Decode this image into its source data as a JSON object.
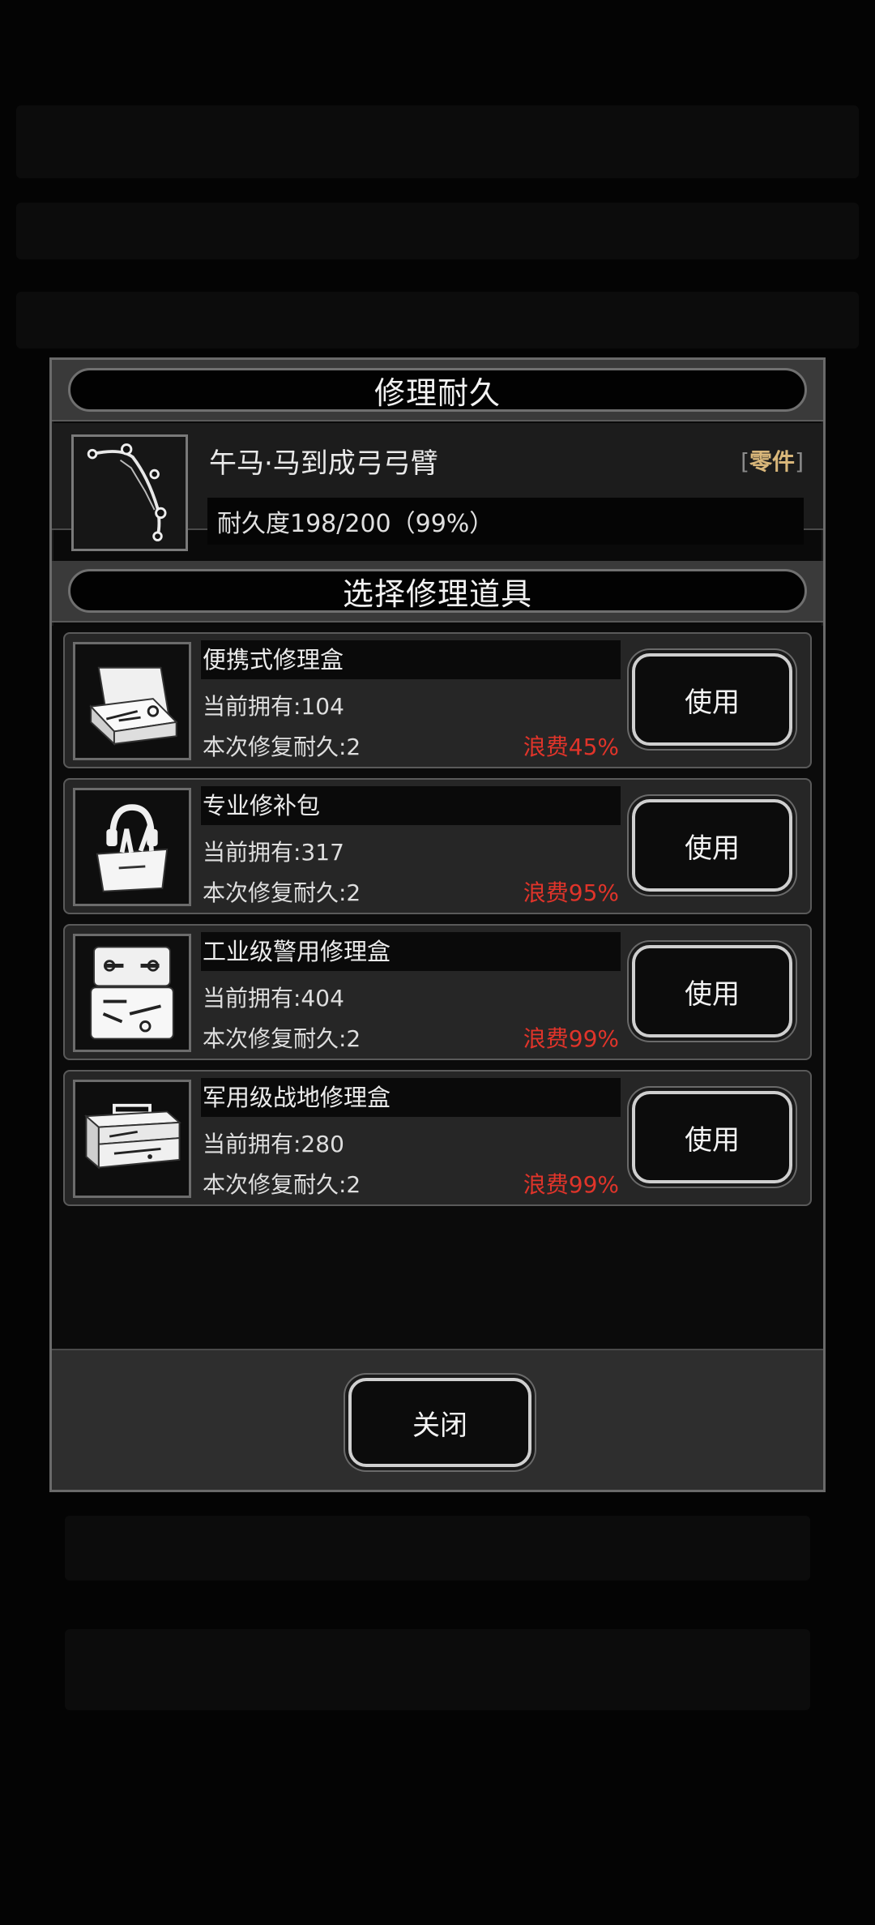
{
  "dialog": {
    "title": "修理耐久",
    "item": {
      "name": "午马·马到成弓弓臂",
      "tag_open": "[",
      "tag": "零件",
      "tag_close": "]",
      "durability": "耐久度198/200（99%）",
      "icon": "bow-arm-icon"
    },
    "tools_title": "选择修理道具",
    "tools": [
      {
        "name": "便携式修理盒",
        "owned": "当前拥有:104",
        "repair": "本次修复耐久:2",
        "waste": "浪费45%",
        "use": "使用",
        "icon": "portable-repair-box-icon"
      },
      {
        "name": "专业修补包",
        "owned": "当前拥有:317",
        "repair": "本次修复耐久:2",
        "waste": "浪费95%",
        "use": "使用",
        "icon": "repair-kit-bag-icon"
      },
      {
        "name": "工业级警用修理盒",
        "owned": "当前拥有:404",
        "repair": "本次修复耐久:2",
        "waste": "浪费99%",
        "use": "使用",
        "icon": "industrial-repair-case-icon"
      },
      {
        "name": "军用级战地修理盒",
        "owned": "当前拥有:280",
        "repair": "本次修复耐久:2",
        "waste": "浪费99%",
        "use": "使用",
        "icon": "military-toolbox-icon"
      }
    ],
    "close": "关闭"
  },
  "colors": {
    "waste_red": "#e0342a",
    "tag_gold": "#d9b77a"
  }
}
